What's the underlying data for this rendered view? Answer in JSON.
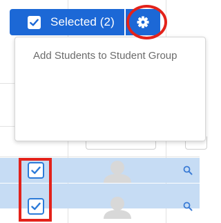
{
  "toolbar": {
    "selected_label": "Selected (2)",
    "accent_color": "#1c68d6",
    "settings_icon": "gear-icon"
  },
  "dropdown": {
    "items": [
      {
        "label": "Add Students to Student Group"
      }
    ]
  },
  "table": {
    "rows": [
      {
        "checked": true,
        "avatar": "person-placeholder-icon",
        "action_icon": "search-icon"
      },
      {
        "checked": true,
        "avatar": "person-placeholder-icon",
        "action_icon": "search-icon"
      }
    ],
    "selected_row_color": "#c6dcf4"
  },
  "annotations": {
    "highlight_color": "#e3221a"
  }
}
